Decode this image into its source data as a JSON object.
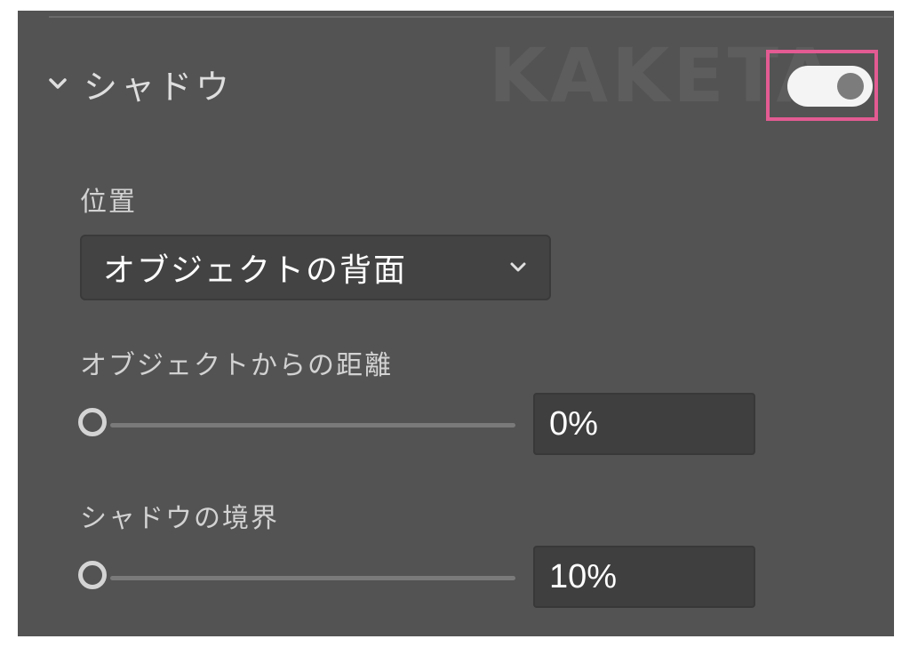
{
  "watermark": "KAKETA",
  "section": {
    "title": "シャドウ",
    "toggle_on": true,
    "toggle_highlight_color": "#e35b92"
  },
  "position": {
    "label": "位置",
    "selected": "オブジェクトの背面"
  },
  "distance": {
    "label": "オブジェクトからの距離",
    "value": "0%"
  },
  "boundary": {
    "label": "シャドウの境界",
    "value": "10%"
  }
}
